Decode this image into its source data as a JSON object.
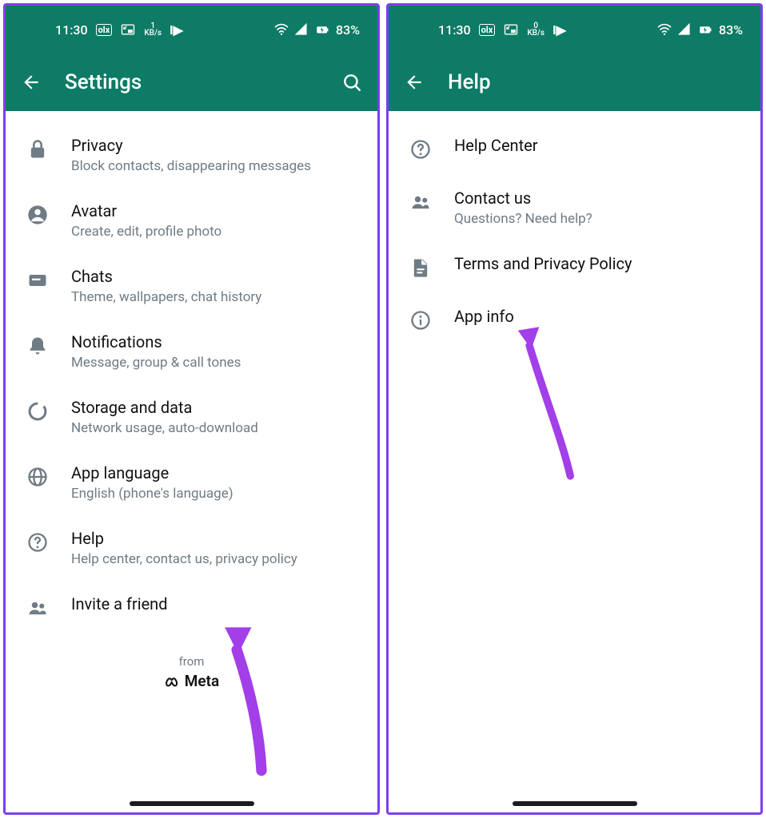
{
  "status": {
    "time": "11:30",
    "net_value": "1",
    "net_unit": "KB/s",
    "net_value2": "0",
    "battery": "83%"
  },
  "left": {
    "title": "Settings",
    "items": [
      {
        "icon": "lock",
        "title": "Privacy",
        "subtitle": "Block contacts, disappearing messages"
      },
      {
        "icon": "avatar",
        "title": "Avatar",
        "subtitle": "Create, edit, profile photo"
      },
      {
        "icon": "chat",
        "title": "Chats",
        "subtitle": "Theme, wallpapers, chat history"
      },
      {
        "icon": "bell",
        "title": "Notifications",
        "subtitle": "Message, group & call tones"
      },
      {
        "icon": "data",
        "title": "Storage and data",
        "subtitle": "Network usage, auto-download"
      },
      {
        "icon": "globe",
        "title": "App language",
        "subtitle": "English (phone's language)"
      },
      {
        "icon": "help",
        "title": "Help",
        "subtitle": "Help center, contact us, privacy policy"
      },
      {
        "icon": "people",
        "title": "Invite a friend",
        "subtitle": ""
      }
    ],
    "from": "from",
    "meta": "Meta"
  },
  "right": {
    "title": "Help",
    "items": [
      {
        "icon": "help",
        "title": "Help Center",
        "subtitle": ""
      },
      {
        "icon": "people",
        "title": "Contact us",
        "subtitle": "Questions? Need help?"
      },
      {
        "icon": "doc",
        "title": "Terms and Privacy Policy",
        "subtitle": ""
      },
      {
        "icon": "info",
        "title": "App info",
        "subtitle": ""
      }
    ]
  }
}
